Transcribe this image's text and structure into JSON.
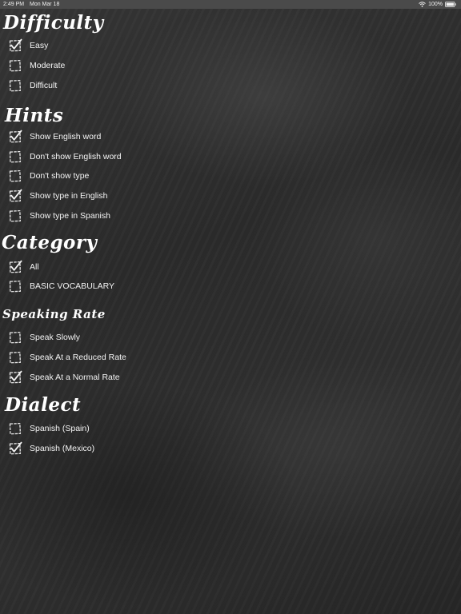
{
  "status_bar": {
    "time": "2:49 PM",
    "date": "Mon Mar 18",
    "battery": "100%"
  },
  "sections": {
    "difficulty": {
      "title": "Difficulty",
      "options": [
        {
          "label": "Easy",
          "checked": true
        },
        {
          "label": "Moderate",
          "checked": false
        },
        {
          "label": "Difficult",
          "checked": false
        }
      ]
    },
    "hints": {
      "title": "Hints",
      "options": [
        {
          "label": "Show English word",
          "checked": true
        },
        {
          "label": "Don't show English word",
          "checked": false
        },
        {
          "label": "Don't show type",
          "checked": false
        },
        {
          "label": "Show type in English",
          "checked": true
        },
        {
          "label": "Show type in Spanish",
          "checked": false
        }
      ]
    },
    "category": {
      "title": "Category",
      "options": [
        {
          "label": "All",
          "checked": true
        },
        {
          "label": "BASIC VOCABULARY",
          "checked": false
        }
      ]
    },
    "speaking_rate": {
      "title": "Speaking Rate",
      "options": [
        {
          "label": "Speak Slowly",
          "checked": false
        },
        {
          "label": "Speak At a Reduced Rate",
          "checked": false
        },
        {
          "label": "Speak At a Normal Rate",
          "checked": true
        }
      ]
    },
    "dialect": {
      "title": "Dialect",
      "options": [
        {
          "label": "Spanish (Spain)",
          "checked": false
        },
        {
          "label": "Spanish (Mexico)",
          "checked": true
        }
      ]
    }
  },
  "colors": {
    "background": "#2e2e2e",
    "text": "#ffffff",
    "status_bar": "#4a4a4a"
  }
}
